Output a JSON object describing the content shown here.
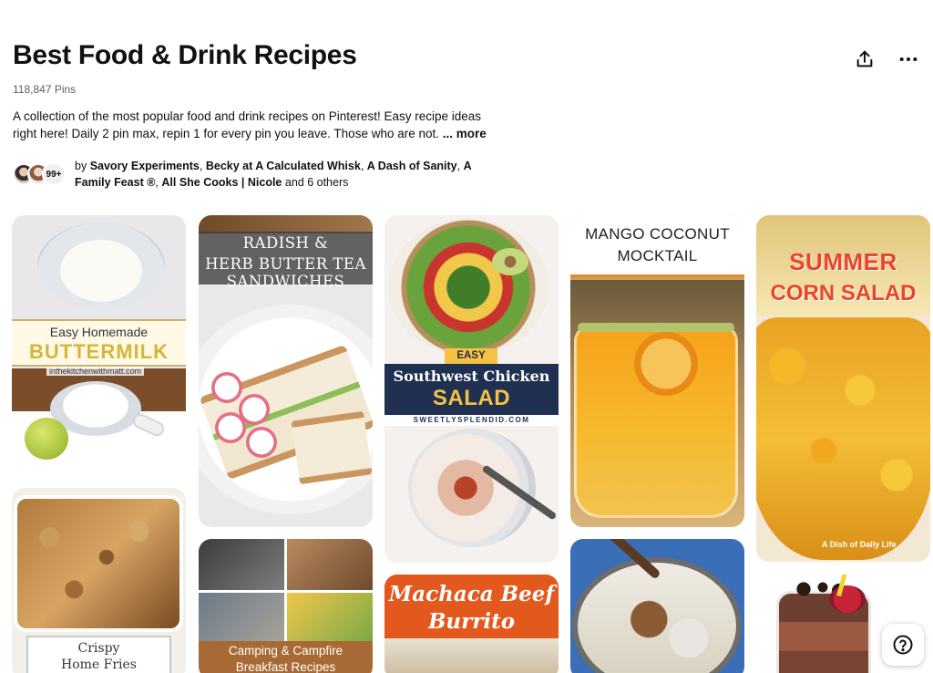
{
  "board": {
    "title": "Best Food & Drink Recipes",
    "pin_count": "118,847 Pins",
    "description": "A collection of the most popular food and drink recipes on Pinterest! Easy recipe ideas right here! Daily 2 pin max, repin 1 for every pin you leave. Those who are not.",
    "more_label": "... more"
  },
  "header_actions": {
    "share_icon": "share-icon",
    "more_icon": "more-options-icon"
  },
  "collaborators": {
    "avatar_count": "99+",
    "by_label": "by",
    "names": [
      "Savory Experiments",
      "Becky at A Calculated Whisk",
      "A Dash of Sanity",
      "A Family Feast ®",
      "All She Cooks | Nicole"
    ],
    "others": "and 6 others"
  },
  "pins": [
    {
      "line1": "Easy Homemade",
      "line2": "BUTTERMILK",
      "watermark": "inthekitchenwithmatt.com"
    },
    {
      "line1": "RADISH &",
      "line2": "HERB BUTTER TEA SANDWICHES"
    },
    {
      "badge": "EASY",
      "line1": "Southwest Chicken",
      "line2": "SALAD",
      "site": "SWEETLYSPLENDID.COM"
    },
    {
      "line1": "MANGO COCONUT",
      "line2": "MOCKTAIL"
    },
    {
      "line1": "SUMMER",
      "line2": "CORN SALAD",
      "brand": "A Dish of Daily Life"
    },
    {
      "line1": "Crispy",
      "line2": "Home Fries"
    },
    {
      "line1": "Camping & Campfire",
      "line2": "Breakfast Recipes"
    },
    {
      "line1": "Machaca Beef",
      "line2": "Burrito"
    },
    {
      "alt": ""
    },
    {
      "alt": ""
    }
  ],
  "help": {
    "icon": "help-icon"
  }
}
